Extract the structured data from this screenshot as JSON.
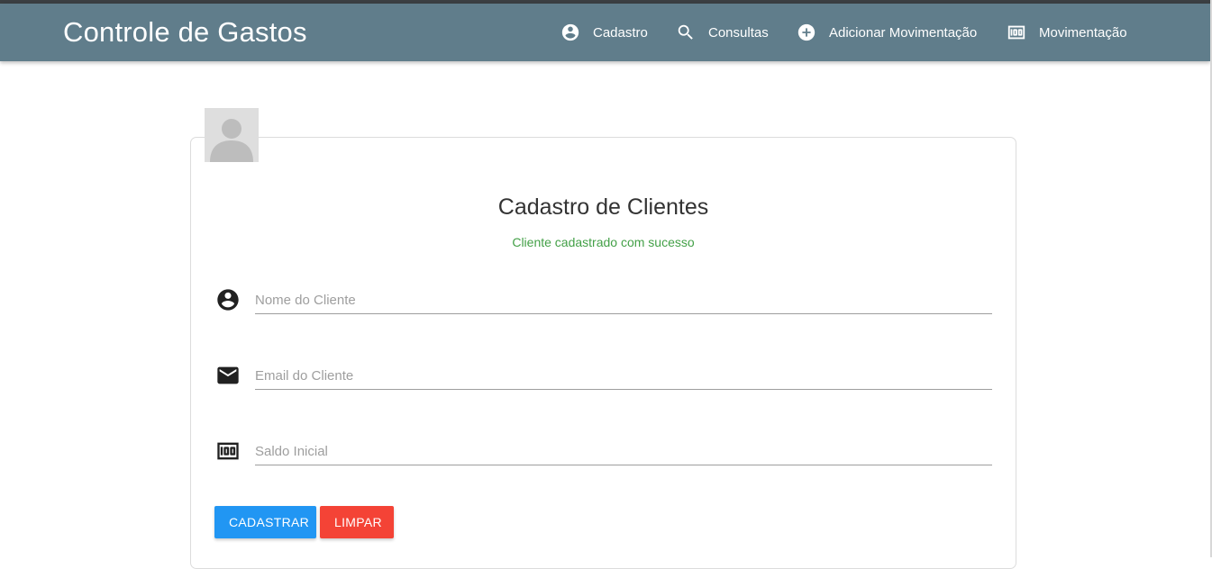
{
  "app": {
    "title": "Controle de Gastos"
  },
  "nav": {
    "items": [
      {
        "label": "Cadastro",
        "icon": "account-circle-icon"
      },
      {
        "label": "Consultas",
        "icon": "search-icon"
      },
      {
        "label": "Adicionar Movimentação",
        "icon": "add-circle-icon"
      },
      {
        "label": "Movimentação",
        "icon": "money-icon"
      }
    ]
  },
  "form": {
    "title": "Cadastro de Clientes",
    "success_message": "Cliente cadastrado com sucesso",
    "fields": {
      "name": {
        "placeholder": "Nome do Cliente",
        "value": "",
        "icon": "account-circle-icon"
      },
      "email": {
        "placeholder": "Email do Cliente",
        "value": "",
        "icon": "email-icon"
      },
      "balance": {
        "placeholder": "Saldo Inicial",
        "value": "",
        "icon": "money-icon"
      }
    },
    "buttons": {
      "submit": "CADASTRAR",
      "clear": "LIMPAR"
    }
  },
  "colors": {
    "navbar": "#607d8b",
    "primary": "#2196f3",
    "danger": "#f44336",
    "success": "#43a047"
  }
}
